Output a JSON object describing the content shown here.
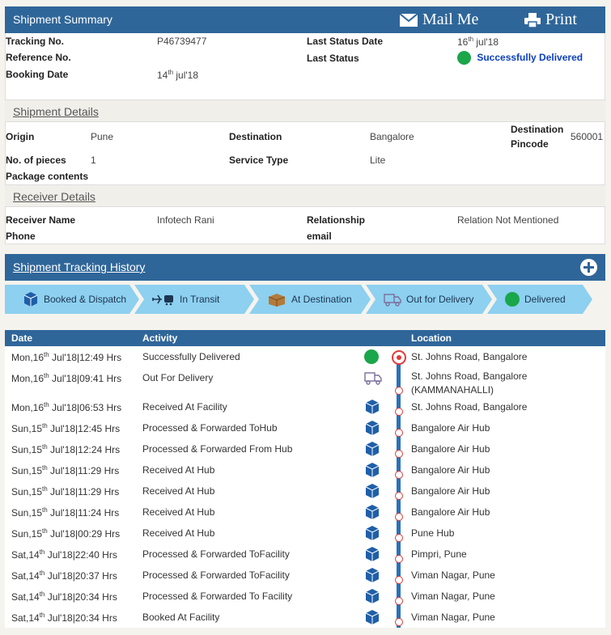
{
  "summary": {
    "title": "Shipment Summary",
    "mail_label": "Mail Me",
    "print_label": "Print",
    "tracking_label": "Tracking No.",
    "tracking_value": "P46739477",
    "reference_label": "Reference No.",
    "reference_value": "",
    "booking_label": "Booking Date",
    "booking_day": "14",
    "booking_suffix": "th",
    "booking_rest": " jul'18",
    "last_status_date_label": "Last Status Date",
    "last_status_day": "16",
    "last_status_suffix": "th",
    "last_status_rest": " jul'18",
    "last_status_label": "Last Status",
    "last_status_value": "Successfully Delivered"
  },
  "details": {
    "title": "Shipment Details",
    "origin_label": "Origin",
    "origin_value": "Pune",
    "destination_label": "Destination",
    "destination_value": "Bangalore",
    "pincode_label_1": "Destination",
    "pincode_label_2": "Pincode",
    "pincode_value": "560001",
    "pieces_label": "No. of pieces",
    "pieces_value": "1",
    "service_label": "Service Type",
    "service_value": "Lite",
    "contents_label": "Package contents"
  },
  "receiver": {
    "title": "Receiver Details",
    "name_label": "Receiver Name",
    "name_value": "Infotech Rani",
    "relationship_label": "Relationship",
    "relationship_value": "Relation Not Mentioned",
    "phone_label": "Phone",
    "email_label": "email"
  },
  "history": {
    "title": "Shipment Tracking History",
    "steps": [
      "Booked & Dispatch",
      "In Transit",
      "At Destination",
      "Out for Delivery",
      "Delivered"
    ],
    "columns": {
      "date": "Date",
      "activity": "Activity",
      "location": "Location"
    },
    "rows": [
      {
        "d": "Mon,16",
        "s": "th",
        "r": " Jul'18|12:49 Hrs",
        "activity": "Successfully Delivered",
        "location": "St. Johns Road, Bangalore",
        "location2": "",
        "icon": "delivered-dot-icon"
      },
      {
        "d": "Mon,16",
        "s": "th",
        "r": " Jul'18|09:41 Hrs",
        "activity": "Out For Delivery",
        "location": "St. Johns Road, Bangalore",
        "location2": "(KAMMANAHALLI)",
        "icon": "delivery-truck-icon"
      },
      {
        "d": "Mon,16",
        "s": "th",
        "r": " Jul'18|06:53 Hrs",
        "activity": "Received At Facility",
        "location": "St. Johns Road, Bangalore",
        "location2": "",
        "icon": "package-icon"
      },
      {
        "d": "Sun,15",
        "s": "th",
        "r": " Jul'18|12:45 Hrs",
        "activity": "Processed & Forwarded ToHub",
        "location": "Bangalore Air Hub",
        "location2": "",
        "icon": "package-icon"
      },
      {
        "d": "Sun,15",
        "s": "th",
        "r": " Jul'18|12:24 Hrs",
        "activity": "Processed & Forwarded From Hub",
        "location": "Bangalore Air Hub",
        "location2": "",
        "icon": "package-icon"
      },
      {
        "d": "Sun,15",
        "s": "th",
        "r": " Jul'18|11:29 Hrs",
        "activity": "Received At Hub",
        "location": "Bangalore Air Hub",
        "location2": "",
        "icon": "package-icon"
      },
      {
        "d": "Sun,15",
        "s": "th",
        "r": " Jul'18|11:29 Hrs",
        "activity": "Received At Hub",
        "location": "Bangalore Air Hub",
        "location2": "",
        "icon": "package-icon"
      },
      {
        "d": "Sun,15",
        "s": "th",
        "r": " Jul'18|11:24 Hrs",
        "activity": "Received At Hub",
        "location": "Bangalore Air Hub",
        "location2": "",
        "icon": "package-icon"
      },
      {
        "d": "Sun,15",
        "s": "th",
        "r": " Jul'18|00:29 Hrs",
        "activity": "Received At Hub",
        "location": "Pune Hub",
        "location2": "",
        "icon": "package-icon"
      },
      {
        "d": "Sat,14",
        "s": "th",
        "r": " Jul'18|22:40 Hrs",
        "activity": "Processed & Forwarded ToFacility",
        "location": "Pimpri, Pune",
        "location2": "",
        "icon": "package-icon"
      },
      {
        "d": "Sat,14",
        "s": "th",
        "r": " Jul'18|20:37 Hrs",
        "activity": "Processed & Forwarded ToFacility",
        "location": "Viman Nagar, Pune",
        "location2": "",
        "icon": "package-icon"
      },
      {
        "d": "Sat,14",
        "s": "th",
        "r": " Jul'18|20:34 Hrs",
        "activity": "Processed & Forwarded To Facility",
        "location": "Viman Nagar, Pune",
        "location2": "",
        "icon": "package-icon"
      },
      {
        "d": "Sat,14",
        "s": "th",
        "r": " Jul'18|20:34 Hrs",
        "activity": "Booked At Facility",
        "location": "Viman Nagar, Pune",
        "location2": "",
        "icon": "package-icon"
      }
    ]
  },
  "colors": {
    "header_blue": "#2f6699",
    "step_blue": "#8dd0f0",
    "delivered_green": "#1aa64a",
    "timeline_red": "#e23a3a"
  }
}
